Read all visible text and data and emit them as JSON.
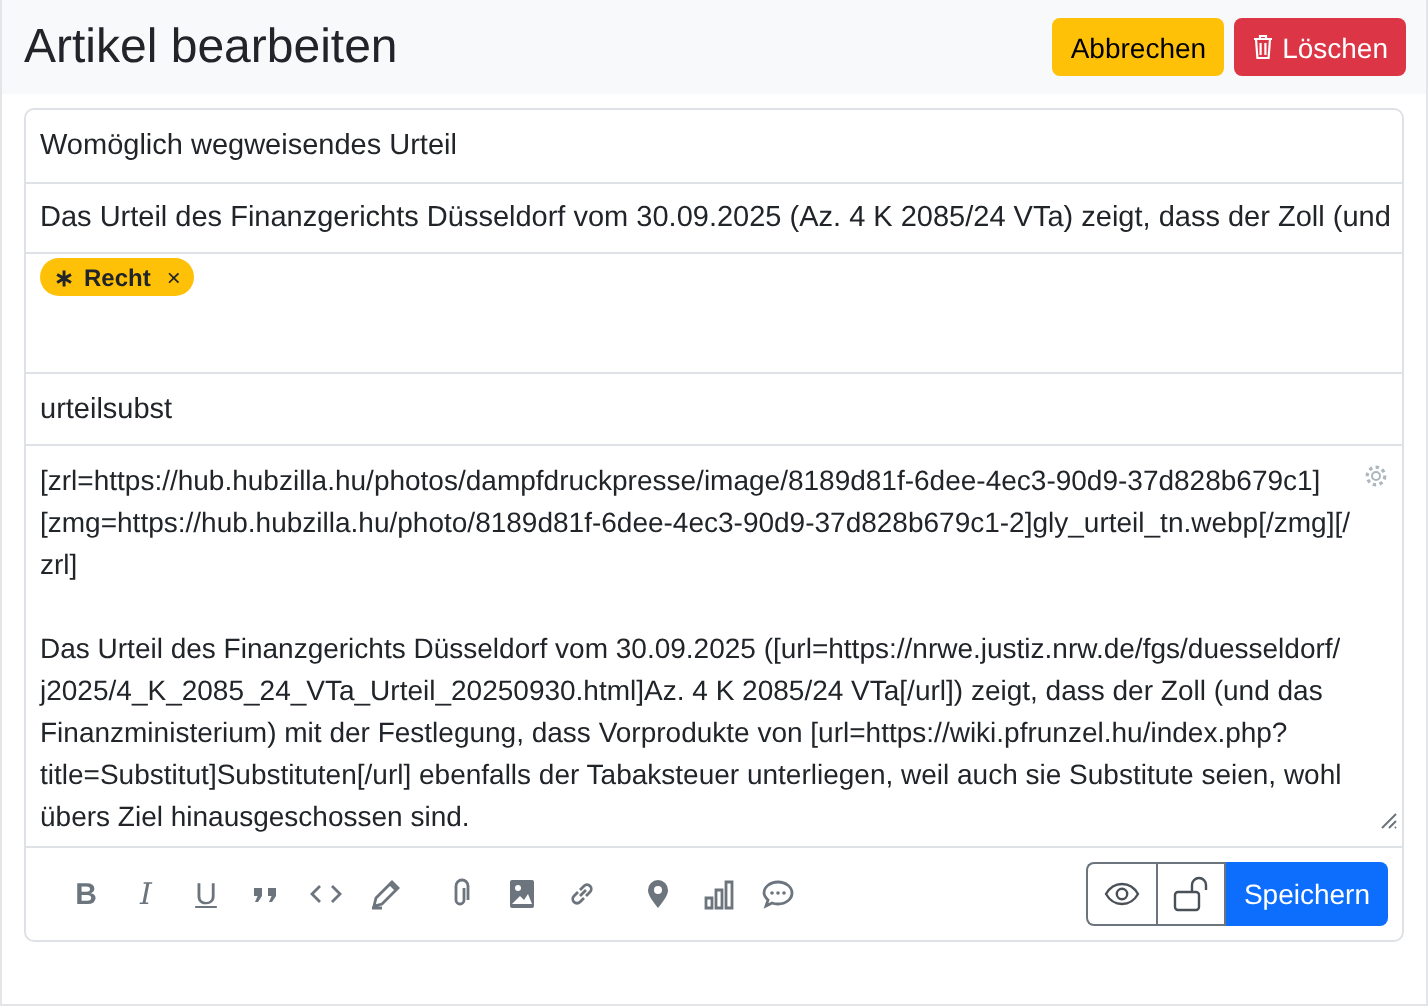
{
  "header": {
    "title": "Artikel bearbeiten",
    "buttons": [
      {
        "label": "Abbrechen",
        "kind": "cancel"
      },
      {
        "label": "Löschen",
        "kind": "delete"
      }
    ]
  },
  "form": {
    "title": {
      "value": "Womöglich wegweisendes Urteil"
    },
    "summary": {
      "value": "Das Urteil des Finanzgerichts Düsseldorf vom 30.09.2025 (Az. 4 K 2085/24 VTa) zeigt, dass der Zoll (und"
    },
    "tags": [
      {
        "icon": "∗",
        "label": "Recht",
        "remove": "×"
      }
    ],
    "category": {
      "value": "urteilsubst"
    },
    "body": {
      "paragraphs": [
        "[zrl=https://hub.hubzilla.hu/photos/dampfdruckpresse/image/8189d81f-6dee-4ec3-90d9-37d828b679c1][zmg=https://hub.hubzilla.hu/photo/8189d81f-6dee-4ec3-90d9-37d828b679c1-2]gly_urteil_tn.webp[/zmg][/zrl]",
        "Das Urteil des Finanzgerichts Düsseldorf vom 30.09.2025 ([url=https://nrwe.justiz.nrw.de/fgs/duesseldorf/j2025/4_K_2085_24_VTa_Urteil_20250930.html]Az. 4 K 2085/24 VTa[/url]) zeigt, dass der Zoll (und das Finanzministerium) mit der Festlegung, dass Vorprodukte von [url=https://wiki.pfrunzel.hu/index.php?title=Substitut]Substituten[/url] ebenfalls der Tabaksteuer unterliegen, weil auch sie Substitute seien, wohl übers Ziel hinausgeschossen sind."
      ]
    }
  },
  "toolbar": {
    "format_buttons": [
      {
        "label": "B",
        "kind": "bold"
      },
      {
        "label": "I",
        "kind": "italic"
      },
      {
        "label": "U",
        "kind": "underline"
      }
    ],
    "locked": false,
    "save_label": "Speichern"
  }
}
